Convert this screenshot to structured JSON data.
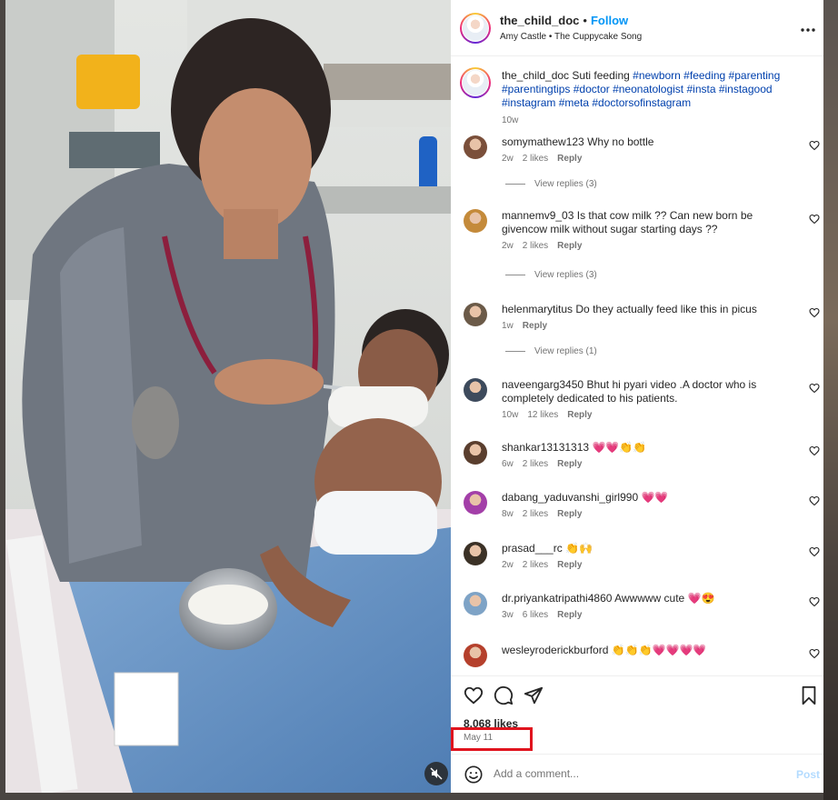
{
  "post": {
    "username": "the_child_doc",
    "follow_label": "Follow",
    "separator": "•",
    "audio": "Amy Castle • The Cuppycake Song",
    "more_label": "•••"
  },
  "caption": {
    "username": "the_child_doc",
    "text": "Suti feeding",
    "hashtags": "#newborn #feeding #parenting #parentingtips #doctor #neonatologist #insta #instagood #instagram #meta #doctorsofinstagram",
    "time": "10w"
  },
  "comments": [
    {
      "user": "somymathew123",
      "text": "Why no bottle",
      "time": "2w",
      "likes": "2 likes",
      "reply": "Reply",
      "view_replies": "View replies (3)",
      "avatar": "#7a4f3a"
    },
    {
      "user": "mannemv9_03",
      "text": "Is that cow milk ?? Can new born be givencow milk without sugar starting days ??",
      "time": "2w",
      "likes": "2 likes",
      "reply": "Reply",
      "view_replies": "View replies (3)",
      "avatar": "#c48a3a"
    },
    {
      "user": "helenmarytitus",
      "text": "Do they actually feed like this in picus",
      "time": "1w",
      "likes": "",
      "reply": "Reply",
      "view_replies": "View replies (1)",
      "avatar": "#6b5a48"
    },
    {
      "user": "naveengarg3450",
      "text": "Bhut hi pyari video .A doctor who is completely dedicated to his patients.",
      "time": "10w",
      "likes": "12 likes",
      "reply": "Reply",
      "view_replies": "",
      "avatar": "#3d4a5c"
    },
    {
      "user": "shankar13131313",
      "text": "💗💗👏👏",
      "time": "6w",
      "likes": "2 likes",
      "reply": "Reply",
      "view_replies": "",
      "avatar": "#5a3e2e"
    },
    {
      "user": "dabang_yaduvanshi_girl990",
      "text": "💗💗",
      "time": "8w",
      "likes": "2 likes",
      "reply": "Reply",
      "view_replies": "",
      "avatar": "#a33fa8"
    },
    {
      "user": "prasad___rc",
      "text": "👏🙌",
      "time": "2w",
      "likes": "2 likes",
      "reply": "Reply",
      "view_replies": "",
      "avatar": "#3b3126"
    },
    {
      "user": "dr.priyankatripathi4860",
      "text": "Awwwww cute 💗😍",
      "time": "3w",
      "likes": "6 likes",
      "reply": "Reply",
      "view_replies": "",
      "avatar": "#7ea3c6"
    },
    {
      "user": "wesleyroderickburford",
      "text": "👏👏👏💗💗💗💗",
      "time": "",
      "likes": "",
      "reply": "",
      "view_replies": "",
      "avatar": "#b5402c"
    }
  ],
  "footer": {
    "likes": "8,068 likes",
    "date": "May 11",
    "comment_placeholder": "Add a comment...",
    "post_label": "Post"
  },
  "icons": {
    "like": "heart-icon",
    "comment": "comment-icon",
    "share": "share-icon",
    "save": "bookmark-icon",
    "emoji": "emoji-icon",
    "mute": "speaker-muted-icon"
  },
  "colors": {
    "link": "#0095f6",
    "hashtag": "#0040ad",
    "highlight": "#e0141e"
  }
}
